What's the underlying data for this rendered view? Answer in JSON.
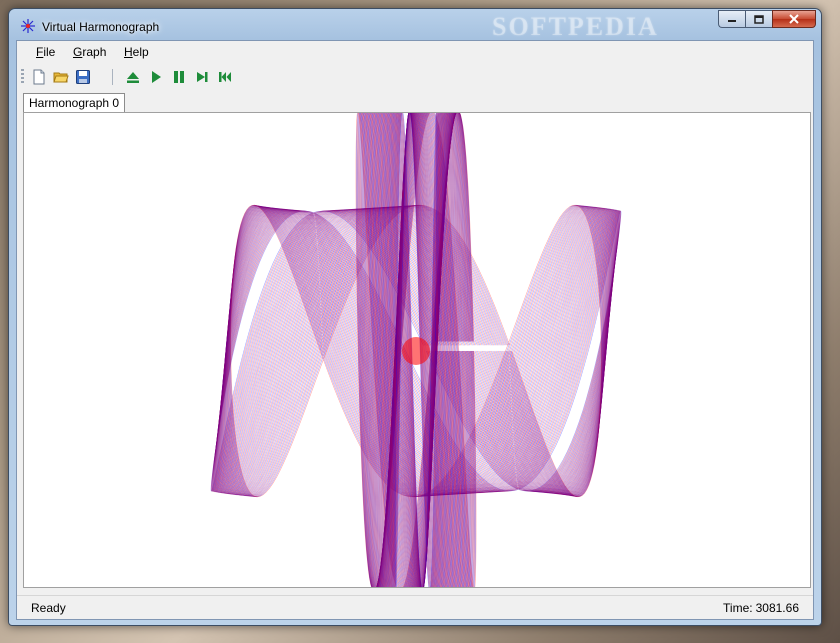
{
  "window": {
    "title": "Virtual Harmonograph",
    "watermark": "SOFTPEDIA"
  },
  "menu": {
    "file": {
      "label": "File",
      "mnemonic": "F",
      "rest": "ile"
    },
    "graph": {
      "label": "Graph",
      "mnemonic": "G",
      "rest": "raph"
    },
    "help": {
      "label": "Help",
      "mnemonic": "H",
      "rest": "elp"
    }
  },
  "toolbar": {
    "buttons": [
      {
        "name": "new-document",
        "icon": "new-page-icon"
      },
      {
        "name": "open-folder",
        "icon": "folder-icon"
      },
      {
        "name": "save",
        "icon": "floppy-disk-icon"
      },
      {
        "name": "eject",
        "icon": "eject-icon"
      },
      {
        "name": "play",
        "icon": "play-icon"
      },
      {
        "name": "pause",
        "icon": "pause-icon"
      },
      {
        "name": "step-forward",
        "icon": "step-forward-icon"
      },
      {
        "name": "rewind",
        "icon": "rewind-icon"
      }
    ]
  },
  "tabs": [
    {
      "label": "Harmonograph 0",
      "active": true
    }
  ],
  "status": {
    "state": "Ready",
    "time_label": "Time:",
    "time_value": "3081.66"
  },
  "colors": {
    "curve_primary": "#ff0000",
    "curve_secondary": "#0000ff",
    "toolbar_green": "#1e8c3a"
  }
}
